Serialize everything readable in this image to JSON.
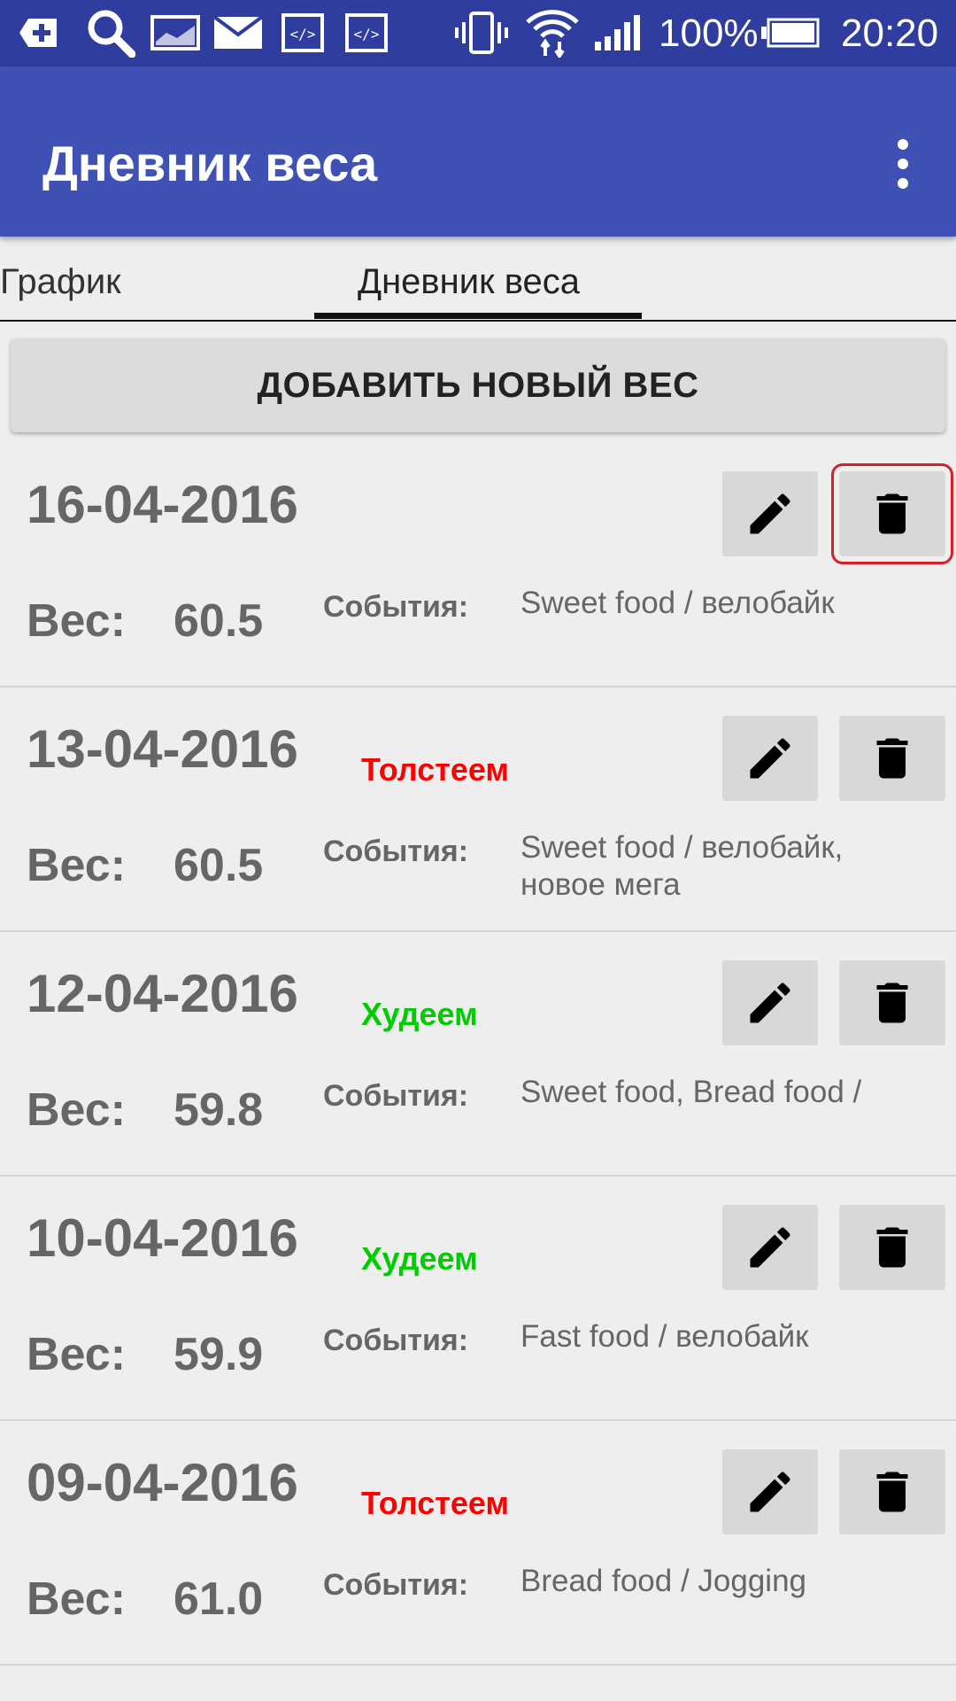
{
  "status_bar": {
    "battery": "100%",
    "time": "20:20",
    "icons": [
      "add-notification-icon",
      "search-icon",
      "gallery-icon",
      "mail-icon",
      "code-icon",
      "code-icon",
      "vibrate-icon",
      "wifi-icon",
      "signal-icon",
      "battery-icon"
    ]
  },
  "app_bar": {
    "title": "Дневник веса",
    "menu_icon": "more-vert-icon"
  },
  "tabs": [
    {
      "label": "График"
    },
    {
      "label": "Дневник веса",
      "active": true
    }
  ],
  "add_button": {
    "label": "ДОБАВИТЬ НОВЫЙ ВЕС"
  },
  "labels": {
    "weight": "Вес:",
    "events": "События:"
  },
  "colors": {
    "gain": "#ff0000",
    "loss": "#00cc00",
    "primary": "#3f51b5",
    "primary_dark": "#2f3d9e"
  },
  "entries": [
    {
      "date": "16-04-2016",
      "trend": "",
      "trend_type": "",
      "weight": "60.5",
      "events": "Sweet food / велобайк",
      "delete_highlighted": true
    },
    {
      "date": "13-04-2016",
      "trend": "Толстеем",
      "trend_type": "gain",
      "weight": "60.5",
      "events": "Sweet food / велобайк, новое мега"
    },
    {
      "date": "12-04-2016",
      "trend": "Худеем",
      "trend_type": "loss",
      "weight": "59.8",
      "events": "Sweet food, Bread food /"
    },
    {
      "date": "10-04-2016",
      "trend": "Худеем",
      "trend_type": "loss",
      "weight": "59.9",
      "events": "Fast food / велобайк"
    },
    {
      "date": "09-04-2016",
      "trend": "Толстеем",
      "trend_type": "gain",
      "weight": "61.0",
      "events": "Bread food / Jogging"
    }
  ]
}
